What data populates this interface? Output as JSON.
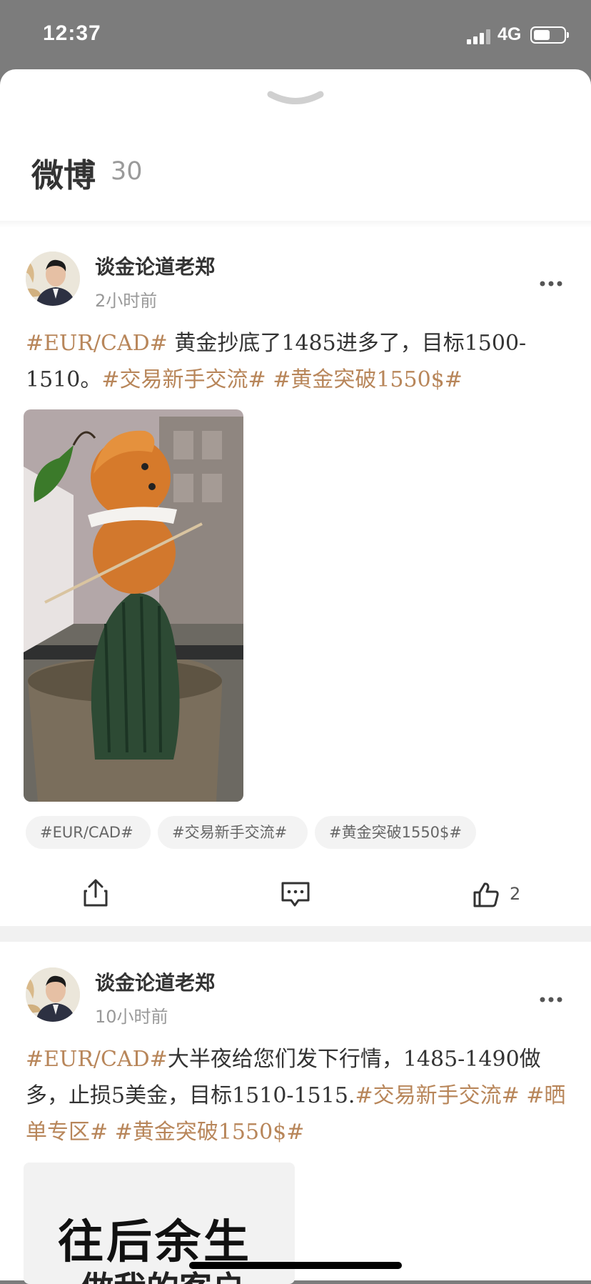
{
  "status_bar": {
    "time": "12:37",
    "network": "4G",
    "battery_level": 0.55
  },
  "sheet": {
    "title": "微博",
    "count": "30"
  },
  "posts": [
    {
      "author": "谈金论道老郑",
      "time": "2小时前",
      "content": [
        {
          "text": "#EUR/CAD#",
          "tag": true
        },
        {
          "text": " 黄金抄底了1485进多了，目标1500-1510。",
          "tag": false
        },
        {
          "text": "#交易新手交流#",
          "tag": true
        },
        {
          "text": " ",
          "tag": false
        },
        {
          "text": "#黄金突破1550$#",
          "tag": true
        }
      ],
      "tags": [
        "#EUR/CAD#",
        "#交易新手交流#",
        "#黄金突破1550$#"
      ],
      "like_count": "2"
    },
    {
      "author": "谈金论道老郑",
      "time": "10小时前",
      "content": [
        {
          "text": "#EUR/CAD#",
          "tag": true
        },
        {
          "text": "大半夜给您们发下行情，1485-1490做多，止损5美金，目标1510-1515.",
          "tag": false
        },
        {
          "text": "#交易新手交流#",
          "tag": true
        },
        {
          "text": " ",
          "tag": false
        },
        {
          "text": "#晒单专区#",
          "tag": true
        },
        {
          "text": " ",
          "tag": false
        },
        {
          "text": "#黄金突破1550$#",
          "tag": true
        }
      ],
      "image_text": "往后余生",
      "image_subtext": "做我的客户"
    }
  ],
  "colors": {
    "tag": "#b8865a",
    "sheet": "#ffffff",
    "backdrop": "#7c7c7c"
  }
}
